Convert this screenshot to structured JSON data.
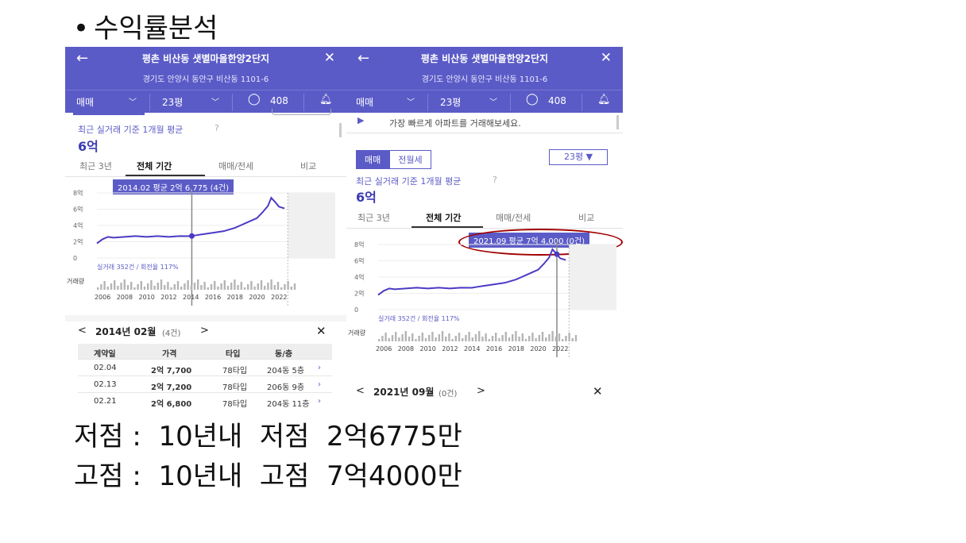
{
  "slide": {
    "bullet": "•",
    "title": "수익률분석",
    "low_line": "저점 :  10년내  저점  2억6775만",
    "high_line": "고점 :  10년내  고점  7억4000만"
  },
  "left": {
    "header": {
      "back_icon": "←",
      "title": "평촌 비산동 샛별마을한양2단지",
      "close_icon": "✕",
      "address": "경기도 안양시 동안구 비산동 1101-6",
      "deal_type": "매매",
      "area": "23평",
      "comments": "408"
    },
    "avg_label": "최근 실거래 기준 1개월 평균",
    "avg_value": "6억",
    "tabs": [
      "최근 3년",
      "전체 기간",
      "매매/전세",
      "비교"
    ],
    "tooltip": "2014.02 평균 2억 6,775 (4건)",
    "y_ticks": [
      "8억",
      "6억",
      "4억",
      "2억",
      "0"
    ],
    "tx_info": "실거래 352건 / 회전율 117%",
    "volume_label": "거래량",
    "x_ticks": [
      "2006",
      "2008",
      "2010",
      "2012",
      "2014",
      "2016",
      "2018",
      "2020",
      "2022"
    ],
    "month_nav": {
      "prev": "<",
      "title": "2014년 02월",
      "count": "(4건)",
      "next": ">",
      "close": "✕"
    },
    "table": {
      "headers": [
        "계약일",
        "가격",
        "타입",
        "동/층"
      ],
      "rows": [
        [
          "02.04",
          "2억 7,700",
          "78타입",
          "204동 5층"
        ],
        [
          "02.13",
          "2억 7,200",
          "78타입",
          "206동 9층"
        ],
        [
          "02.21",
          "2억 6,800",
          "78타입",
          "204동 11층"
        ]
      ]
    }
  },
  "right": {
    "header": {
      "back_icon": "←",
      "title": "평촌 비산동 샛별마을한양2단지",
      "close_icon": "✕",
      "address": "경기도 안양시 동안구 비산동 1101-6",
      "deal_type": "매매",
      "area": "23평",
      "comments": "408"
    },
    "promo": "가장 빠르게 아파트를 거래해보세요.",
    "pill_tabs": [
      "매매",
      "전월세"
    ],
    "area_select": "23평 ▼",
    "avg_label": "최근 실거래 기준 1개월 평균",
    "avg_value": "6억",
    "tabs": [
      "최근 3년",
      "전체 기간",
      "매매/전세",
      "비교"
    ],
    "tooltip": "2021.09 평균 7억 4,000 (0건)",
    "y_ticks": [
      "8억",
      "6억",
      "4억",
      "2억",
      "0"
    ],
    "tx_info": "실거래 352건 / 회전율 117%",
    "volume_label": "거래량",
    "x_ticks": [
      "2006",
      "2008",
      "2010",
      "2012",
      "2014",
      "2016",
      "2018",
      "2020",
      "2022"
    ],
    "month_nav": {
      "prev": "<",
      "title": "2021년 09월",
      "count": "(0건)",
      "next": ">",
      "close": "✕"
    }
  },
  "chart_data": {
    "type": "line",
    "x": [
      2005.5,
      2006,
      2006.5,
      2007,
      2008,
      2009,
      2010,
      2011,
      2012,
      2013,
      2014,
      2014.5,
      2015,
      2016,
      2017,
      2018,
      2018.5,
      2019,
      2019.5,
      2020,
      2020.5,
      2021,
      2021.3,
      2021.7,
      2022,
      2022.5
    ],
    "y": [
      1.8,
      2.3,
      2.6,
      2.5,
      2.6,
      2.7,
      2.6,
      2.7,
      2.6,
      2.7,
      2.68,
      2.8,
      2.9,
      3.1,
      3.3,
      3.7,
      4.0,
      4.3,
      4.6,
      4.9,
      5.6,
      6.4,
      7.4,
      6.8,
      6.3,
      6.1
    ],
    "ylabel": "",
    "ylim": [
      0,
      8
    ],
    "xlim": [
      2005.5,
      2023.5
    ],
    "colors": {
      "line": "#4b3bc4",
      "accent": "#5b5bc7",
      "highlight": "#a00000"
    }
  }
}
